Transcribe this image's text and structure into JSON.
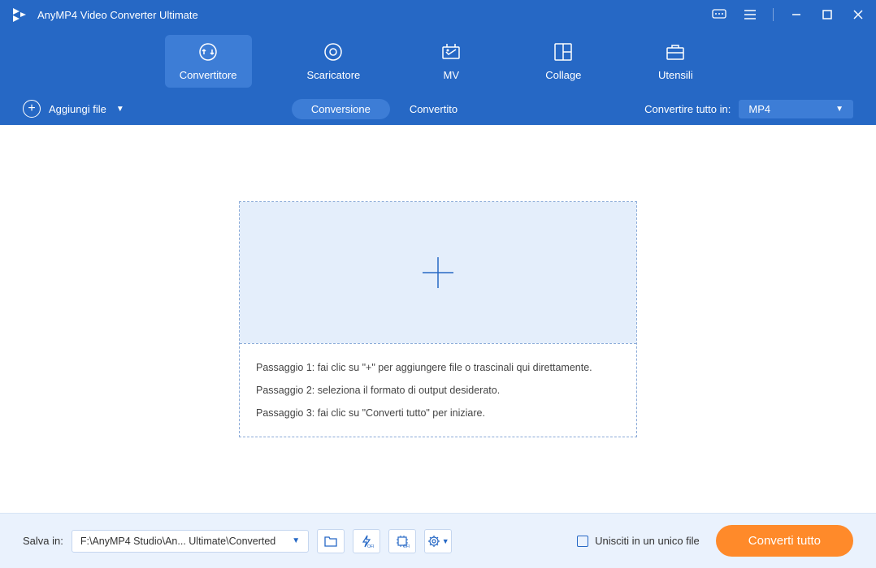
{
  "titlebar": {
    "app_name": "AnyMP4 Video Converter Ultimate"
  },
  "nav": {
    "items": [
      {
        "label": "Convertitore",
        "active": true
      },
      {
        "label": "Scaricatore",
        "active": false
      },
      {
        "label": "MV",
        "active": false
      },
      {
        "label": "Collage",
        "active": false
      },
      {
        "label": "Utensili",
        "active": false
      }
    ]
  },
  "toolbar": {
    "add_file_label": "Aggiungi file",
    "tab_conversion": "Conversione",
    "tab_converted": "Convertito",
    "convert_all_label": "Convertire tutto in:",
    "format_selected": "MP4"
  },
  "dropzone": {
    "step1": "Passaggio 1: fai clic su \"+\" per aggiungere file o trascinali qui direttamente.",
    "step2": "Passaggio 2: seleziona il formato di output desiderato.",
    "step3": "Passaggio 3: fai clic su \"Converti tutto\" per iniziare."
  },
  "footer": {
    "save_label": "Salva in:",
    "save_path": "F:\\AnyMP4 Studio\\An... Ultimate\\Converted",
    "merge_label": "Unisciti in un unico file",
    "convert_button": "Converti tutto"
  }
}
